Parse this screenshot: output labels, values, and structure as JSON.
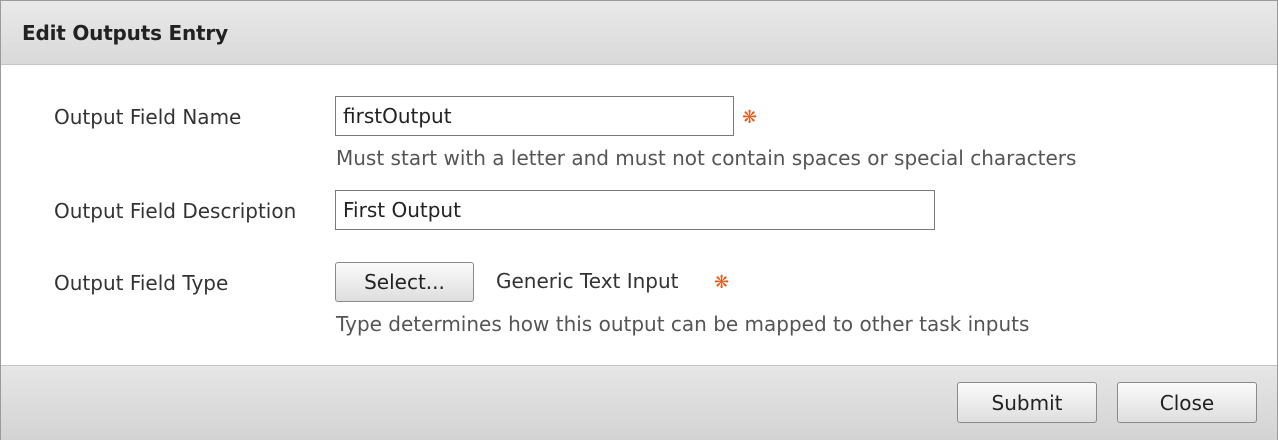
{
  "dialog": {
    "title": "Edit Outputs Entry"
  },
  "form": {
    "name": {
      "label": "Output Field Name",
      "value": "firstOutput",
      "required_mark": "❋",
      "hint": "Must start with a letter and must not contain spaces or special characters"
    },
    "description": {
      "label": "Output Field Description",
      "value": "First Output"
    },
    "type": {
      "label": "Output Field Type",
      "select_label": "Select...",
      "selected_value": "Generic Text Input",
      "required_mark": "❋",
      "hint": "Type determines how this output can be mapped to other task inputs"
    }
  },
  "footer": {
    "submit_label": "Submit",
    "close_label": "Close"
  },
  "colors": {
    "required": "#e55b1a",
    "titlebar": "#e0e0e0"
  }
}
